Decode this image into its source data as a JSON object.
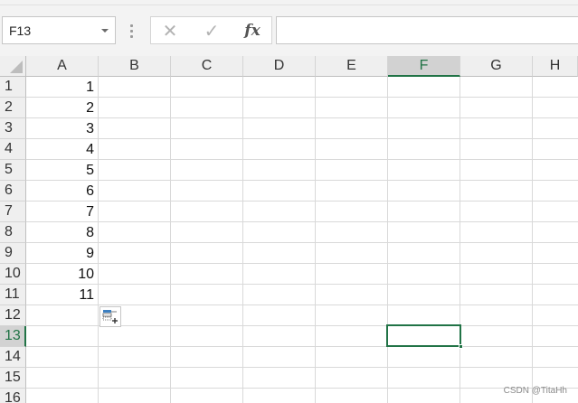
{
  "formula_bar": {
    "name_box": "F13",
    "cancel_glyph": "✕",
    "enter_glyph": "✓",
    "fx_label": "fx",
    "formula_value": ""
  },
  "grid": {
    "columns": [
      "A",
      "B",
      "C",
      "D",
      "E",
      "F",
      "G",
      "H"
    ],
    "rows": [
      "1",
      "2",
      "3",
      "4",
      "5",
      "6",
      "7",
      "8",
      "9",
      "10",
      "11",
      "12",
      "13",
      "14",
      "15",
      "16"
    ],
    "selected_cell": "F13",
    "column_a_values": [
      "1",
      "2",
      "3",
      "4",
      "5",
      "6",
      "7",
      "8",
      "9",
      "10",
      "11"
    ]
  },
  "icons": {
    "autofill_options": "autofill-options-icon",
    "select_all": "select-all-triangle-icon"
  },
  "colors": {
    "accent": "#217346",
    "header_bg": "#efefef",
    "gridline": "#d9d9d9"
  },
  "watermark": "CSDN @TitaHh"
}
